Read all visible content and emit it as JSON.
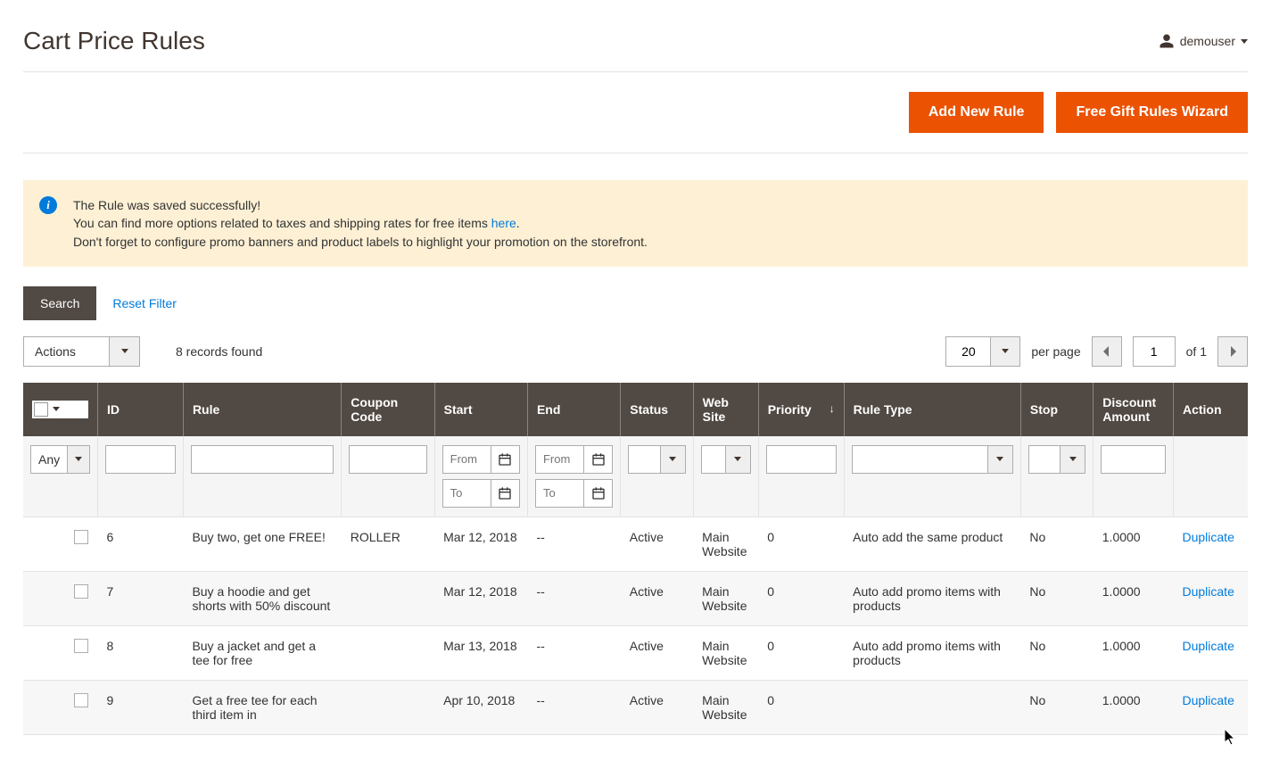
{
  "header": {
    "title": "Cart Price Rules",
    "username": "demouser"
  },
  "buttons": {
    "add_new": "Add New Rule",
    "wizard": "Free Gift Rules Wizard",
    "search": "Search",
    "reset_filter": "Reset Filter"
  },
  "notice": {
    "line1": "The Rule was saved successfully!",
    "line2_pre": "You can find more options related to taxes and shipping rates for free items ",
    "line2_link": "here",
    "line2_post": ".",
    "line3": "Don't forget to configure promo banners and product labels to highlight your promotion on the storefront."
  },
  "grid": {
    "actions_label": "Actions",
    "records_found": "8 records found",
    "per_page_value": "20",
    "per_page_label": "per page",
    "page_current": "1",
    "page_of": "of 1"
  },
  "filters": {
    "any": "Any",
    "from": "From",
    "to": "To"
  },
  "columns": {
    "id": "ID",
    "rule": "Rule",
    "coupon": "Coupon Code",
    "start": "Start",
    "end": "End",
    "status": "Status",
    "website": "Web Site",
    "priority": "Priority",
    "ruletype": "Rule Type",
    "stop": "Stop",
    "discount": "Discount Amount",
    "action": "Action"
  },
  "rows": [
    {
      "id": "6",
      "rule": "Buy two, get one FREE!",
      "coupon": "ROLLER",
      "start": "Mar 12, 2018",
      "end": "--",
      "status": "Active",
      "website": "Main Website",
      "priority": "0",
      "ruletype": "Auto add the same product",
      "stop": "No",
      "discount": "1.0000",
      "action": "Duplicate"
    },
    {
      "id": "7",
      "rule": "Buy a hoodie and get shorts with 50% discount",
      "coupon": "",
      "start": "Mar 12, 2018",
      "end": "--",
      "status": "Active",
      "website": "Main Website",
      "priority": "0",
      "ruletype": "Auto add promo items with products",
      "stop": "No",
      "discount": "1.0000",
      "action": "Duplicate"
    },
    {
      "id": "8",
      "rule": "Buy a jacket and get a tee for free",
      "coupon": "",
      "start": "Mar 13, 2018",
      "end": "--",
      "status": "Active",
      "website": "Main Website",
      "priority": "0",
      "ruletype": "Auto add promo items with products",
      "stop": "No",
      "discount": "1.0000",
      "action": "Duplicate"
    },
    {
      "id": "9",
      "rule": "Get a free tee for each third item in",
      "coupon": "",
      "start": "Apr 10, 2018",
      "end": "--",
      "status": "Active",
      "website": "Main Website",
      "priority": "0",
      "ruletype": "",
      "stop": "No",
      "discount": "1.0000",
      "action": "Duplicate"
    }
  ]
}
